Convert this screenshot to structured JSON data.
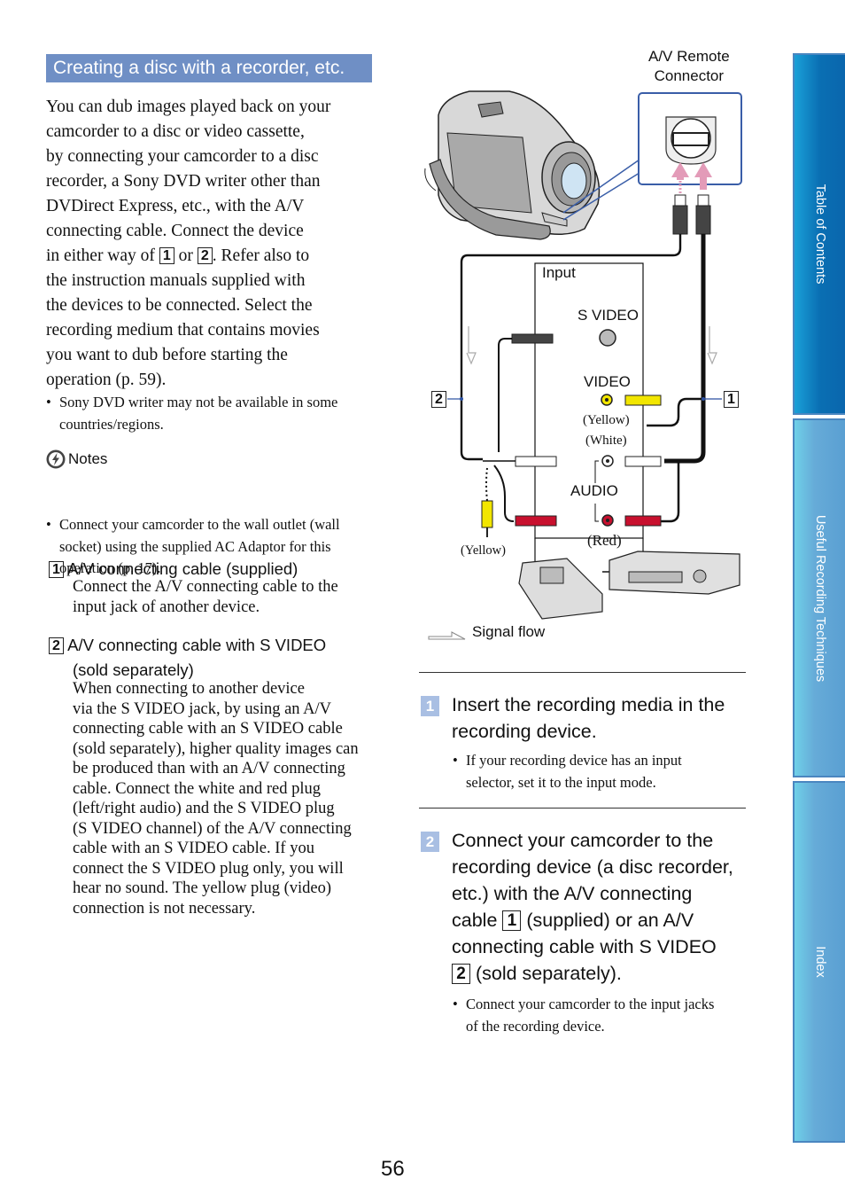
{
  "section_title": "Creating a disc with a recorder, etc.",
  "intro": {
    "lines": [
      "You can dub images played back on your",
      "camcorder to a disc or video cassette,",
      "by connecting your camcorder to a disc",
      "recorder, a Sony DVD writer other than",
      "DVDirect Express, etc., with the A/V",
      "connecting cable. Connect the device"
    ],
    "either_way_pre": "in either way of",
    "either_way_or": "or",
    "either_way_post": ". Refer also to",
    "lines_after": [
      "the instruction manuals supplied with",
      "the devices to be connected. Select the",
      "recording medium that contains movies",
      "you want to dub before starting the",
      "operation (p. 59)."
    ],
    "bullet_lines": [
      "Sony DVD writer may not be available in some",
      "countries/regions."
    ]
  },
  "notes": {
    "heading": "Notes",
    "icon": "notes-lightning-icon",
    "bullet_lines": [
      "Connect your camcorder to the wall outlet (wall",
      "socket) using the supplied AC Adaptor for this",
      "operation (p. 17)."
    ]
  },
  "cables": [
    {
      "number": "1",
      "title": "A/V connecting cable (supplied)",
      "body_lines": [
        "Connect the A/V connecting cable to the",
        "input jack of another device."
      ]
    },
    {
      "number": "2",
      "title_lines": [
        "A/V connecting cable with S VIDEO",
        "(sold separately)"
      ],
      "body_lines": [
        "When connecting to another device",
        "via the S VIDEO jack, by using an A/V",
        "connecting cable with an S VIDEO cable",
        "(sold separately), higher quality images can",
        "be produced than with an A/V connecting",
        "cable. Connect the white and red plug",
        "(left/right audio) and the S VIDEO plug",
        "(S VIDEO channel) of the A/V connecting",
        "cable with an S VIDEO cable. If you",
        "connect the S VIDEO plug only, you will",
        "hear no sound. The yellow plug (video)",
        "connection is not necessary."
      ]
    }
  ],
  "diagram": {
    "av_remote_label_line1": "A/V Remote",
    "av_remote_label_line2": "Connector",
    "input_label": "Input",
    "s_video_label": "S VIDEO",
    "video_label": "VIDEO",
    "yellow_label": "(Yellow)",
    "white_label": "(White)",
    "audio_label": "AUDIO",
    "red_label": "(Red)",
    "yellow_plug_label": "(Yellow)",
    "signal_flow_label": "Signal flow",
    "callout_1": "1",
    "callout_2": "2",
    "colors": {
      "yellow_plug": "#f2e600",
      "red_plug": "#c8102e",
      "arrow_pink": "#e39bb8",
      "callout_line": "#2a4fa0",
      "connector_box": "#3a5ea8"
    }
  },
  "steps": [
    {
      "number": "1",
      "title_lines": [
        "Insert the recording media in the",
        "recording device."
      ],
      "bullet_lines": [
        "If your recording device has an input",
        "selector, set it to the input mode."
      ]
    },
    {
      "number": "2",
      "title_line1": "Connect your camcorder to the",
      "title_line2": "recording device (a disc recorder,",
      "title_line3": "etc.) with the A/V connecting",
      "title_line4_pre": "cable",
      "title_line4_box": "1",
      "title_line4_post": "(supplied) or an A/V",
      "title_line5": "connecting cable with S VIDEO",
      "title_line6_box": "2",
      "title_line6_post": "(sold separately).",
      "bullet_lines": [
        "Connect your camcorder to the input jacks",
        "of the recording device."
      ]
    }
  ],
  "side_tabs": [
    {
      "label": "Table of Contents"
    },
    {
      "label": "Useful Recording Techniques"
    },
    {
      "label": "Index"
    }
  ],
  "page_number": "56"
}
